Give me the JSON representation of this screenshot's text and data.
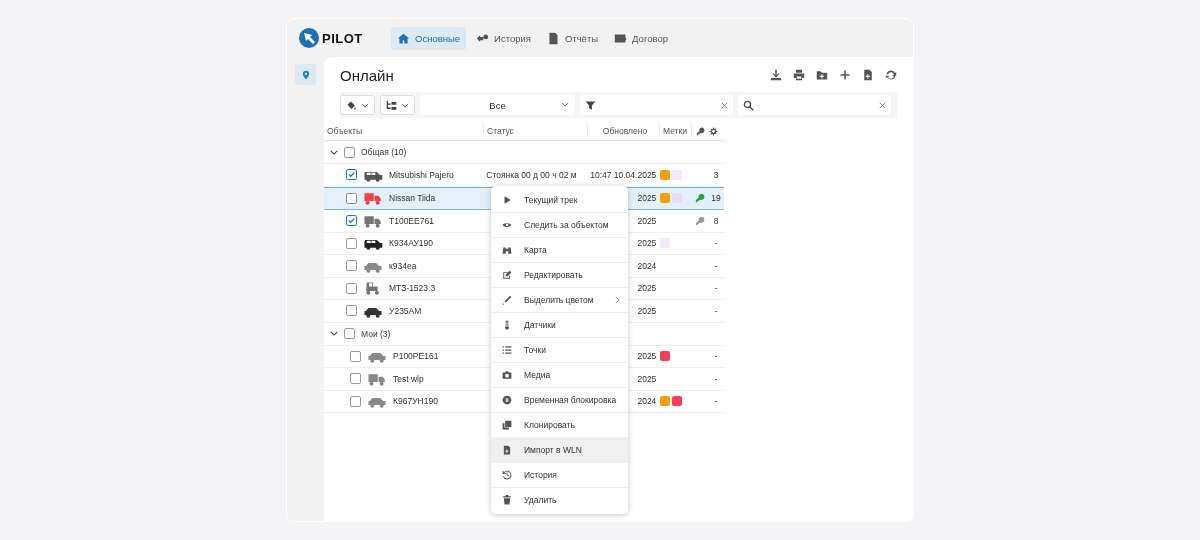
{
  "brand": "PILOT",
  "nav": [
    {
      "label": "Основные",
      "selected": true
    },
    {
      "label": "История",
      "selected": false
    },
    {
      "label": "Отчёты",
      "selected": false
    },
    {
      "label": "Договор",
      "selected": false
    }
  ],
  "title": "Онлайн",
  "filters": {
    "group_select": "Все"
  },
  "columns": [
    "Объекты",
    "Статус",
    "Обновлено",
    "Метки"
  ],
  "groups": [
    {
      "name": "Общая (10)",
      "expanded": true,
      "checked": false,
      "rows": [
        {
          "name": "Mitsubishi Pajero",
          "kind": "suv",
          "color": "#555555",
          "checked": true,
          "selected": false,
          "status": "Стоянка 00 д 00 ч 02 м",
          "updated": "10:47 10.04.2025",
          "tags": [
            {
              "color": "#f59e0b"
            },
            {
              "color": "#f6e6fa"
            }
          ],
          "count": "3"
        },
        {
          "name": "Nissan Tiida",
          "kind": "truck",
          "color": "#ef4444",
          "checked": false,
          "selected": true,
          "updated": "2025",
          "tags": [
            {
              "color": "#f59e0b"
            },
            {
              "color": "#e6dcf5"
            }
          ],
          "key": {
            "active": true
          },
          "count": "19"
        },
        {
          "name": "T100EE761",
          "kind": "truck",
          "color": "#777777",
          "checked": true,
          "selected": false,
          "updated": "2025",
          "key": {
            "active": false
          },
          "count": "8"
        },
        {
          "name": "К934АУ190",
          "kind": "suv",
          "color": "#222222",
          "checked": false,
          "selected": false,
          "updated": "2025",
          "tags": [
            {
              "color": "#f6e6fa"
            }
          ],
          "count": "-"
        },
        {
          "name": "к934еа",
          "kind": "car",
          "color": "#888888",
          "checked": false,
          "selected": false,
          "updated": "2024",
          "count": "-"
        },
        {
          "name": "МТЗ-1523.3",
          "kind": "tractor",
          "color": "#777777",
          "checked": false,
          "selected": false,
          "updated": "2025",
          "count": "-"
        },
        {
          "name": "У235АМ",
          "kind": "car",
          "color": "#333333",
          "checked": false,
          "selected": false,
          "updated": "2025",
          "count": "-"
        }
      ]
    },
    {
      "name": "Мои (3)",
      "expanded": true,
      "checked": false,
      "rows": [
        {
          "name": "Р100РЕ161",
          "kind": "car",
          "color": "#888888",
          "checked": false,
          "selected": false,
          "updated": "2025",
          "tags": [
            {
              "color": "#f43f5e"
            }
          ],
          "count": "-"
        },
        {
          "name": "Test wlp",
          "kind": "truck",
          "color": "#888888",
          "checked": false,
          "selected": false,
          "updated": "2025",
          "count": "-"
        },
        {
          "name": "К967УН190",
          "kind": "car",
          "color": "#888888",
          "checked": false,
          "selected": false,
          "updated": "2024",
          "tags": [
            {
              "color": "#f59e0b"
            },
            {
              "color": "#f43f5e"
            }
          ],
          "count": "-"
        }
      ]
    }
  ],
  "context_menu": [
    {
      "label": "Текущий трек",
      "highlighted": false,
      "submenu": false
    },
    {
      "label": "Следить за объектом",
      "highlighted": false,
      "submenu": false
    },
    {
      "label": "Карта",
      "highlighted": false,
      "submenu": false
    },
    {
      "label": "Редактировать",
      "highlighted": false,
      "submenu": false
    },
    {
      "label": "Выделить цветом",
      "highlighted": false,
      "submenu": true
    },
    {
      "label": "Датчики",
      "highlighted": false,
      "submenu": false
    },
    {
      "label": "Точки",
      "highlighted": false,
      "submenu": false
    },
    {
      "label": "Медиа",
      "highlighted": false,
      "submenu": false
    },
    {
      "label": "Временная блокировка",
      "highlighted": false,
      "submenu": false
    },
    {
      "label": "Клонировать",
      "highlighted": false,
      "submenu": false
    },
    {
      "label": "Импорт в WLN",
      "highlighted": true,
      "submenu": false
    },
    {
      "label": "История",
      "highlighted": false,
      "submenu": false
    },
    {
      "label": "Удалить",
      "highlighted": false,
      "submenu": false
    }
  ]
}
